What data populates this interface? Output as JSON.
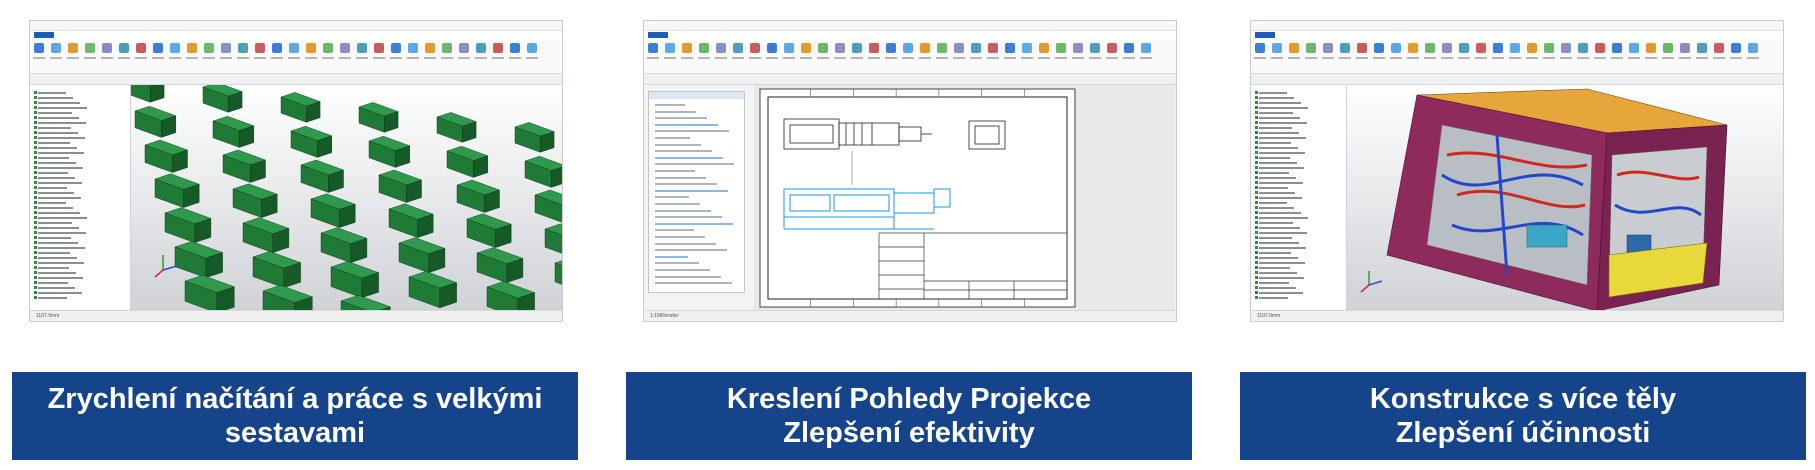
{
  "panels": [
    {
      "id": "assembly",
      "caption": [
        "Zrychlení načítání a práce s velkými",
        "sestavami"
      ],
      "status": "1107.9mm"
    },
    {
      "id": "drawing",
      "caption": [
        "Kreslení Pohledy Projekce",
        "Zlepšení efektivity"
      ],
      "status": "1:1Millimeter"
    },
    {
      "id": "multibody",
      "caption": [
        "Konstrukce s více těly",
        "Zlepšení účinnosti"
      ],
      "status": "1107.9mm"
    }
  ],
  "colors": {
    "caption_bg": "#15448a",
    "caption_text": "#ffffff",
    "ribbon_active": "#1e5db8",
    "model_green": "#1f7a36",
    "drawing_blue": "#1a9ae0",
    "tree_green": "#2e8b3e"
  }
}
